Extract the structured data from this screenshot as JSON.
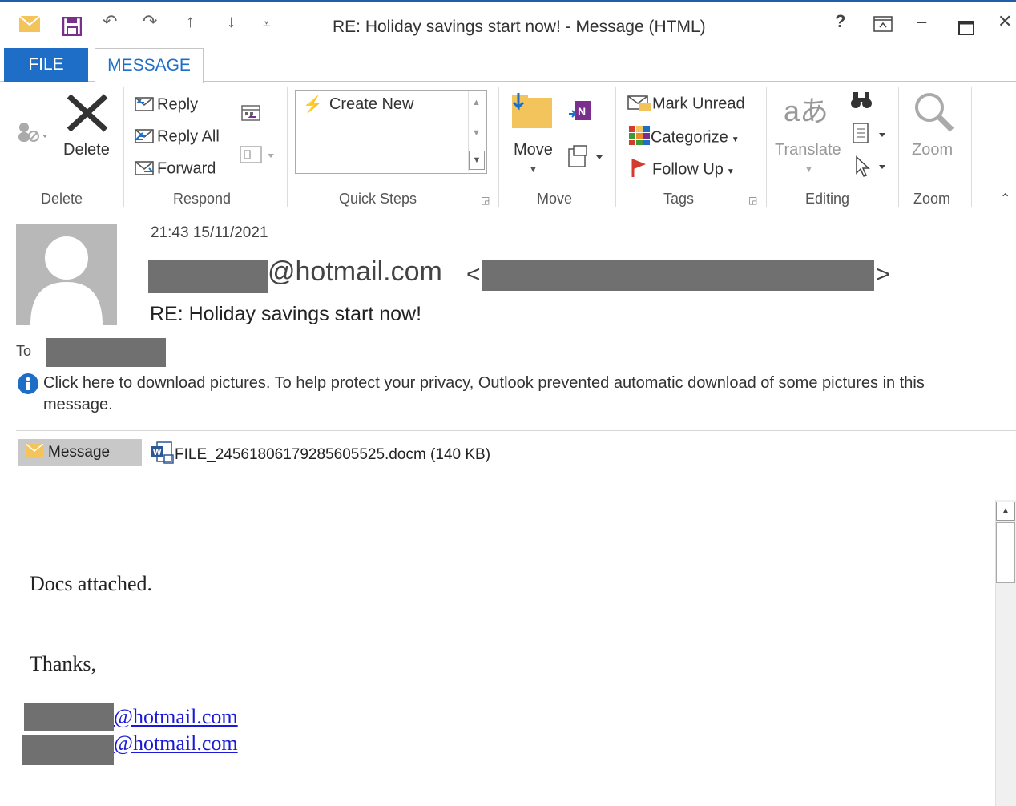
{
  "window": {
    "title": "RE: Holiday savings start now! - Message (HTML)",
    "help": "?",
    "controls": [
      "restore-ribbon",
      "minimize",
      "maximize",
      "close"
    ]
  },
  "tabs": {
    "file": "FILE",
    "message": "MESSAGE"
  },
  "ribbon": {
    "delete_group": {
      "delete": "Delete",
      "label": "Delete"
    },
    "respond_group": {
      "reply": "Reply",
      "reply_all": "Reply All",
      "forward": "Forward",
      "label": "Respond"
    },
    "quick_steps_group": {
      "create_new": "Create New",
      "label": "Quick Steps"
    },
    "move_group": {
      "move": "Move",
      "label": "Move"
    },
    "tags_group": {
      "mark_unread": "Mark Unread",
      "categorize": "Categorize",
      "follow_up": "Follow Up",
      "label": "Tags"
    },
    "editing_group": {
      "translate": "Translate",
      "label": "Editing"
    },
    "zoom_group": {
      "zoom": "Zoom",
      "label": "Zoom"
    }
  },
  "header": {
    "datetime": "21:43 15/11/2021",
    "sender_domain": "@hotmail.com",
    "angle_open": "<",
    "angle_close": ">",
    "subject": "RE: Holiday savings start now!",
    "to_label": "To"
  },
  "info_bar": {
    "text": "Click here to download pictures. To help protect your privacy, Outlook prevented automatic download of some pictures in this message."
  },
  "attachments": {
    "message_tab": "Message",
    "file": "FILE_24561806179285605525.docm (140 KB)"
  },
  "body": {
    "line1": "Docs attached.",
    "line2": "Thanks,",
    "links": [
      "@hotmail.com",
      "@hotmail.com"
    ]
  },
  "colors": {
    "accent": "#1e6ec8",
    "redaction": "#707070",
    "link": "#1a1ad6"
  }
}
